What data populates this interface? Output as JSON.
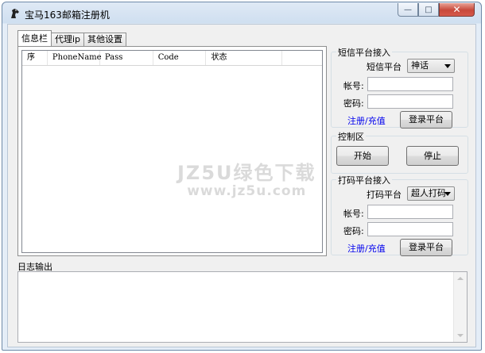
{
  "window": {
    "title": "宝马163邮箱注册机",
    "controls": {
      "minimize": "—",
      "maximize": "□",
      "close": "✕"
    }
  },
  "tabs": [
    {
      "label": "信息栏",
      "active": true
    },
    {
      "label": "代理ip",
      "active": false
    },
    {
      "label": "其他设置",
      "active": false
    }
  ],
  "table": {
    "columns": [
      "序",
      "PhoneName",
      "Pass",
      "Code",
      "状态"
    ]
  },
  "sms_group": {
    "title": "短信平台接入",
    "platform_label": "短信平台",
    "platform_value": "神话",
    "account_label": "帐号:",
    "password_label": "密码:",
    "register_link": "注册/充值",
    "login_button": "登录平台"
  },
  "control_group": {
    "title": "控制区",
    "start_button": "开始",
    "stop_button": "停止"
  },
  "captcha_group": {
    "title": "打码平台接入",
    "platform_label": "打码平台",
    "platform_value": "超人打码",
    "account_label": "帐号:",
    "password_label": "密码:",
    "register_link": "注册/充值",
    "login_button": "登录平台"
  },
  "log": {
    "label": "日志输出"
  },
  "watermark": {
    "line1": "JZ5U绿色下载",
    "line2": "www.jz5u.com"
  }
}
